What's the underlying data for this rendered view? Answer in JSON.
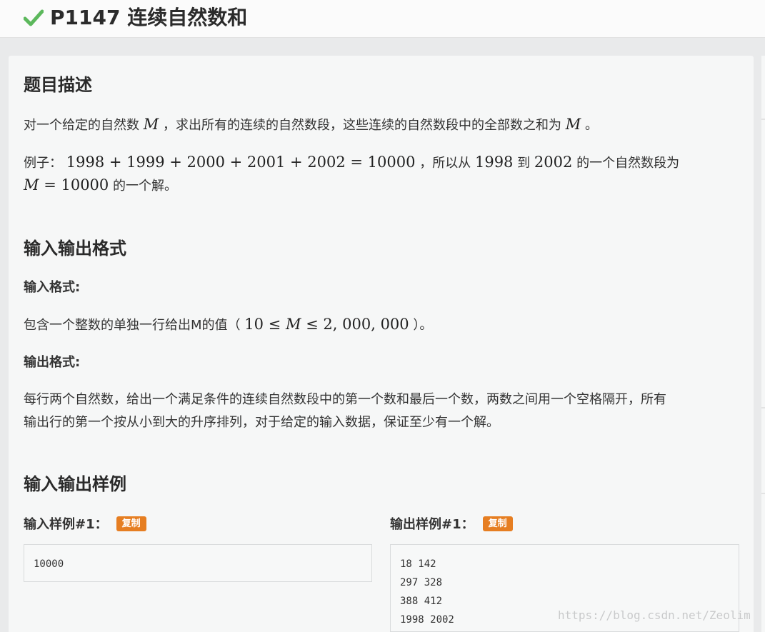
{
  "header": {
    "title": "P1147 连续自然数和"
  },
  "problem": {
    "desc_heading": "题目描述",
    "desc_text_1": "对一个给定的自然数",
    "desc_var_m": "M",
    "desc_text_2": "，求出所有的连续的自然数段，这些连续的自然数段中的全部数之和为",
    "desc_text_3": "。",
    "example_prefix": "例子：",
    "example_math": "1998 + 1999 + 2000 + 2001 + 2002 = 10000",
    "example_mid_1": "，所以从",
    "example_from": "1998",
    "example_mid_2": "到",
    "example_to": "2002",
    "example_mid_3": "的一个自然数段为",
    "example_math_2_var": "M",
    "example_math_2_rest": "= 10000",
    "example_suffix": "的一个解。"
  },
  "io": {
    "heading": "输入输出格式",
    "input_label": "输入格式:",
    "input_text_1": "包含一个整数的单独一行给出M的值（",
    "input_math_lo": "10 ≤",
    "input_math_var": "M",
    "input_math_hi": "≤ 2, 000, 000",
    "input_text_2": "）。",
    "output_label": "输出格式:",
    "output_line_1": "每行两个自然数，给出一个满足条件的连续自然数段中的第一个数和最后一个数，两数之间用一个空格隔开，所有",
    "output_line_2": "输出行的第一个按从小到大的升序排列，对于给定的输入数据，保证至少有一个解。"
  },
  "samples": {
    "heading": "输入输出样例",
    "input_label": "输入样例#1：",
    "output_label": "输出样例#1：",
    "copy_label": "复制",
    "input_lines": [
      "10000"
    ],
    "output_lines": [
      "18 142",
      "297 328",
      "388 412",
      "1998 2002"
    ]
  },
  "watermark": "https://blog.csdn.net/Zeolim",
  "colors": {
    "accent_check": "#5cb85c",
    "copy_button": "#e67e22"
  }
}
